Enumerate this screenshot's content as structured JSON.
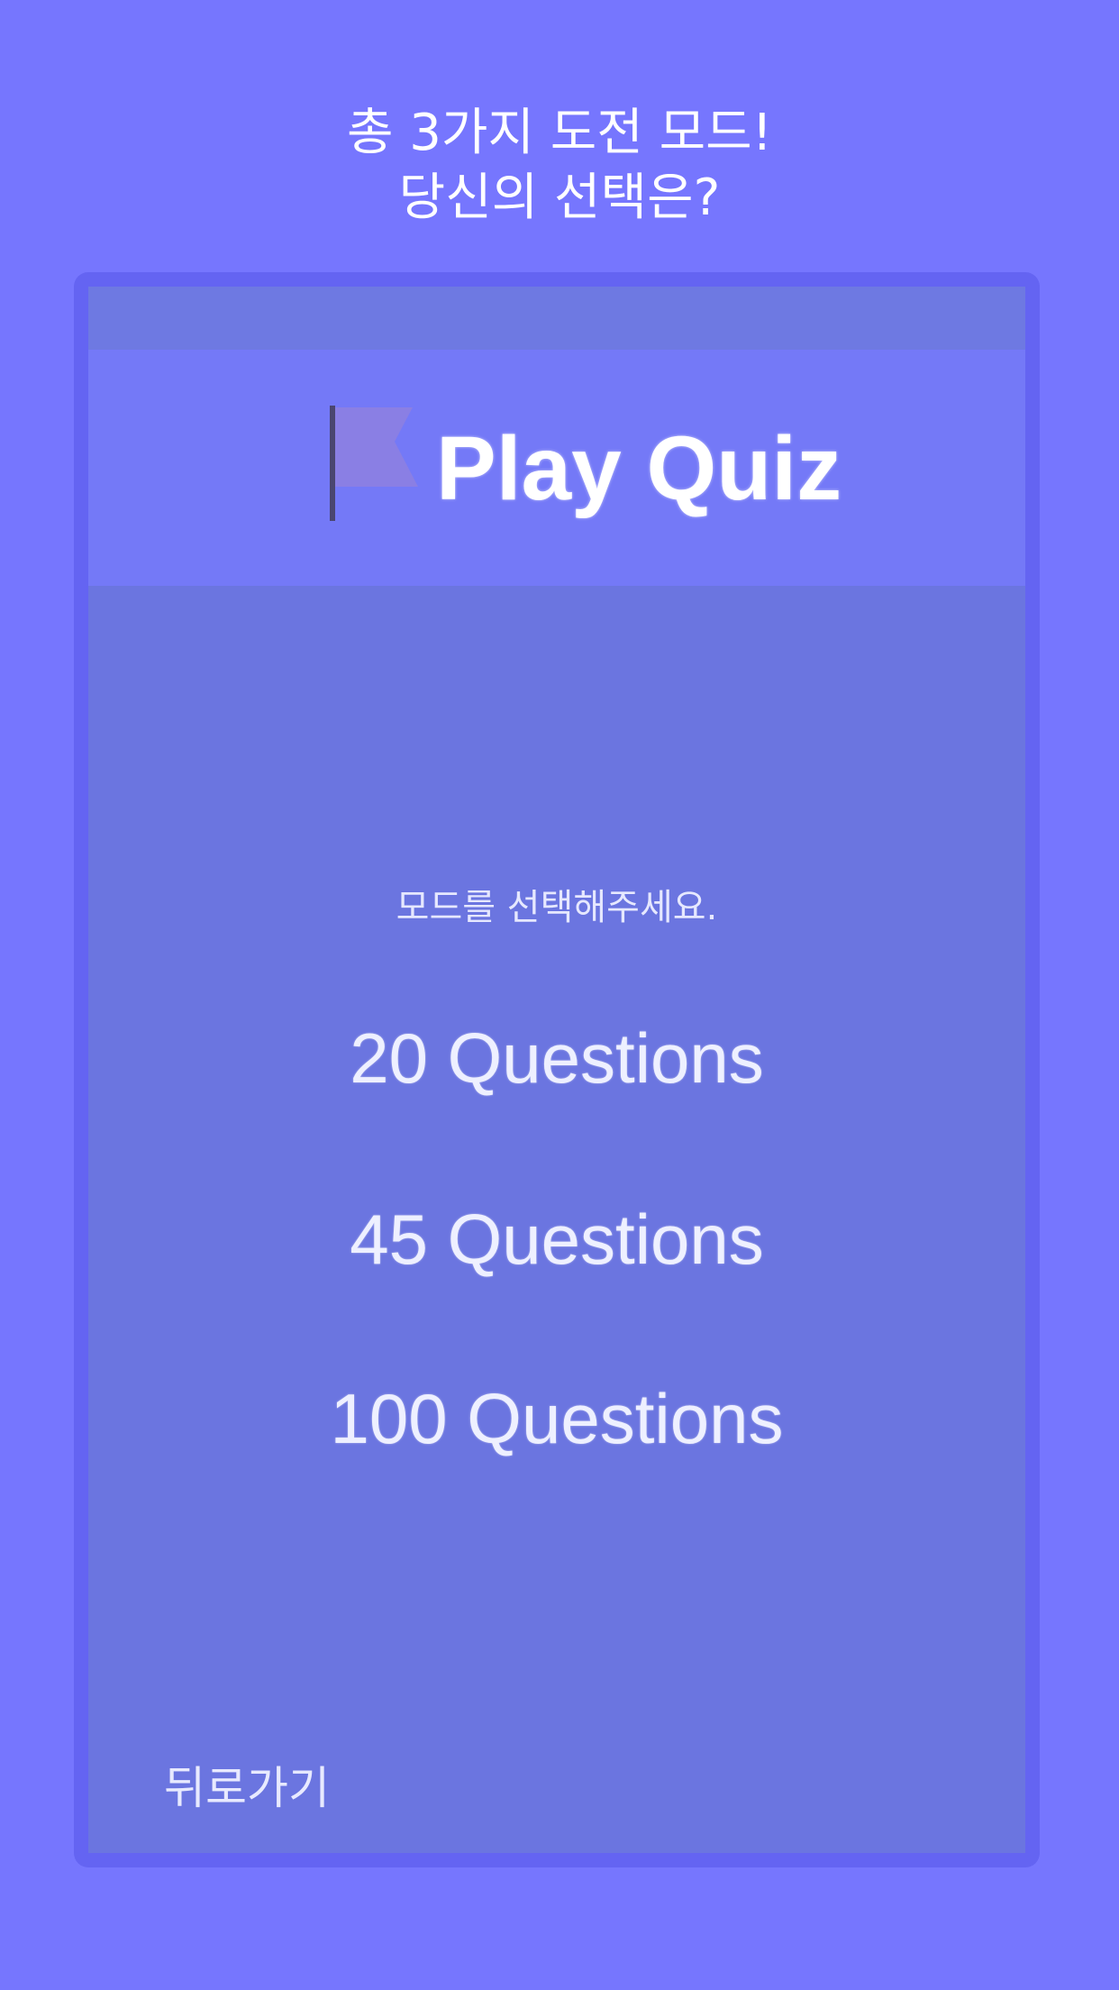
{
  "promo": {
    "line1": "총 3가지 도전 모드!",
    "line2": "당신의 선택은?"
  },
  "app": {
    "logo_icon": "flag-icon",
    "title": "Play Quiz"
  },
  "content": {
    "prompt": "모드를 선택해주세요.",
    "modes": [
      {
        "label": "20 Questions"
      },
      {
        "label": "45 Questions"
      },
      {
        "label": "100 Questions"
      }
    ],
    "back_label": "뒤로가기"
  },
  "colors": {
    "background": "#7676fe",
    "device_frame": "#6464f2",
    "screen": "#6b75e0",
    "header": "#7479f7",
    "flag": "#8a7fe4",
    "flag_pole": "#4a4670"
  }
}
